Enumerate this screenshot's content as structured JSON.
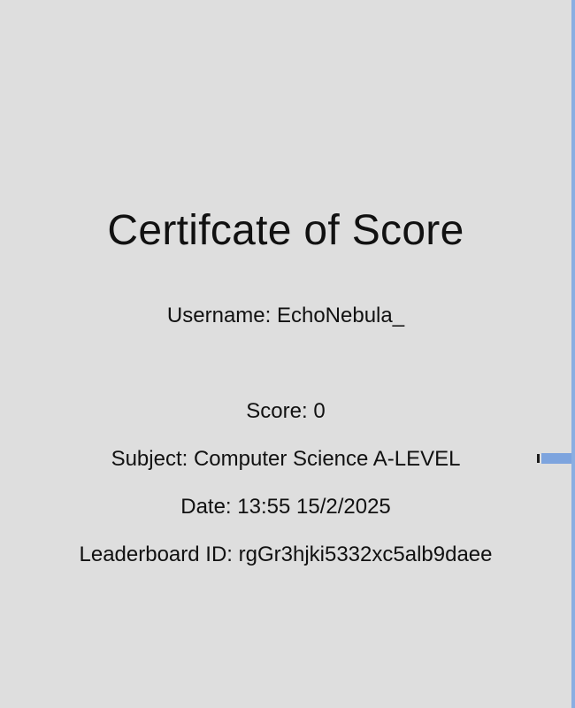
{
  "certificate": {
    "title": "Certifcate of Score",
    "username": "Username: EchoNebula_",
    "score": "Score: 0",
    "subject": "Subject: Computer Science A-LEVEL",
    "date": "Date: 13:55 15/2/2025",
    "leaderboard_id": "Leaderboard ID: rgGr3hjki5332xc5alb9daee"
  },
  "colors": {
    "background": "#dedede",
    "text": "#111111",
    "right_edge": "#8aaee2",
    "connector": "#7da4de"
  }
}
